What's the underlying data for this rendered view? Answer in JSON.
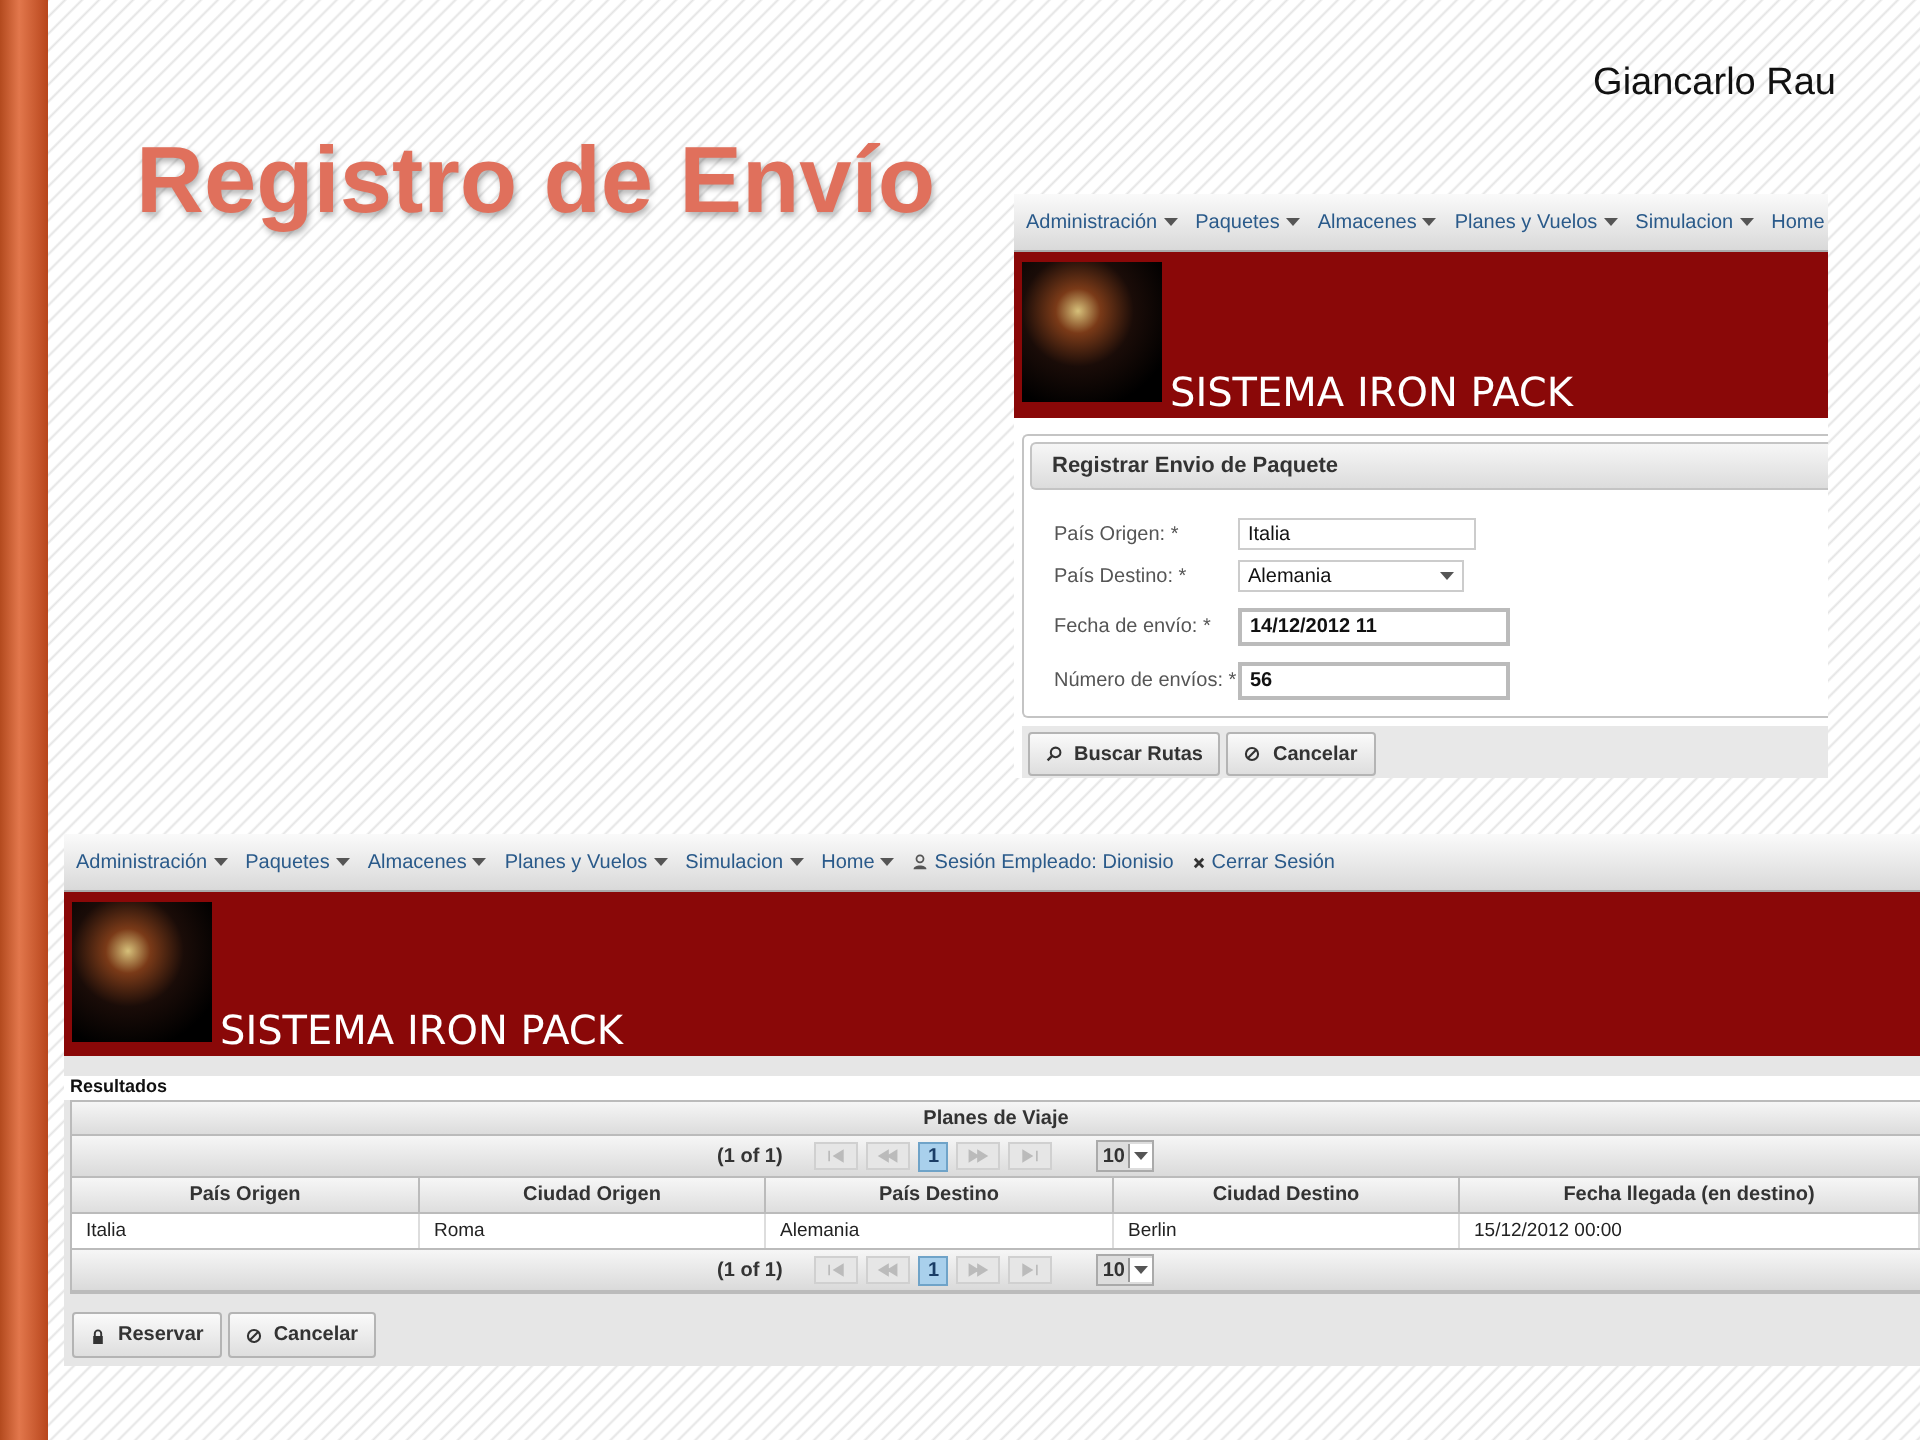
{
  "slide": {
    "title": "Registro de Envío",
    "author": "Giancarlo Rau"
  },
  "form_screen": {
    "menu": [
      {
        "label": "Administración",
        "kind": "dropdown"
      },
      {
        "label": "Paquetes",
        "kind": "dropdown"
      },
      {
        "label": "Almacenes",
        "kind": "dropdown"
      },
      {
        "label": "Planes y Vuelos",
        "kind": "dropdown"
      },
      {
        "label": "Simulacion",
        "kind": "dropdown"
      },
      {
        "label": "Home",
        "kind": "dropdown"
      }
    ],
    "banner": {
      "title": "SISTEMA IRON PACK"
    },
    "panel": {
      "title": "Registrar Envio de Paquete",
      "fields": [
        {
          "label": "País Origen: *",
          "value": "Italia",
          "kind": "short"
        },
        {
          "label": "País Destino: *",
          "value": "Alemania",
          "kind": "select"
        },
        {
          "label": "Fecha de envío: *",
          "value": "14/12/2012 11",
          "kind": "wide"
        },
        {
          "label": "Número de envíos: *",
          "value": "56",
          "kind": "wide"
        }
      ]
    },
    "buttons": [
      {
        "label": "Buscar Rutas",
        "kind": "search"
      },
      {
        "label": "Cancelar",
        "kind": "cancel"
      }
    ]
  },
  "results_screen": {
    "menu": [
      {
        "label": "Administración",
        "kind": "dropdown"
      },
      {
        "label": "Paquetes",
        "kind": "dropdown"
      },
      {
        "label": "Almacenes",
        "kind": "dropdown"
      },
      {
        "label": "Planes y Vuelos",
        "kind": "dropdown"
      },
      {
        "label": "Simulacion",
        "kind": "dropdown"
      },
      {
        "label": "Home",
        "kind": "dropdown"
      },
      {
        "label": "Sesión Empleado: Dionisio",
        "kind": "user"
      },
      {
        "label": "Cerrar Sesión",
        "kind": "close"
      }
    ],
    "banner": {
      "title": "SISTEMA IRON PACK"
    },
    "section_title": "Resultados",
    "table": {
      "title": "Planes de Viaje",
      "paginator_top": {
        "summary": "(1 of 1)",
        "pages": [
          {
            "label": "1",
            "selected": true
          }
        ],
        "rows_per_page": "10"
      },
      "columns": [
        "País Origen",
        "Ciudad Origen",
        "País Destino",
        "Ciudad Destino",
        "Fecha llegada (en destino)"
      ],
      "rows": [
        [
          "Italia",
          "Roma",
          "Alemania",
          "Berlin",
          "15/12/2012 00:00"
        ]
      ],
      "paginator_bottom": {
        "summary": "(1 of 1)",
        "pages": [
          {
            "label": "1",
            "selected": true
          }
        ],
        "rows_per_page": "10"
      }
    },
    "buttons": [
      {
        "label": "Reservar",
        "kind": "lock"
      },
      {
        "label": "Cancelar",
        "kind": "cancel"
      }
    ]
  }
}
